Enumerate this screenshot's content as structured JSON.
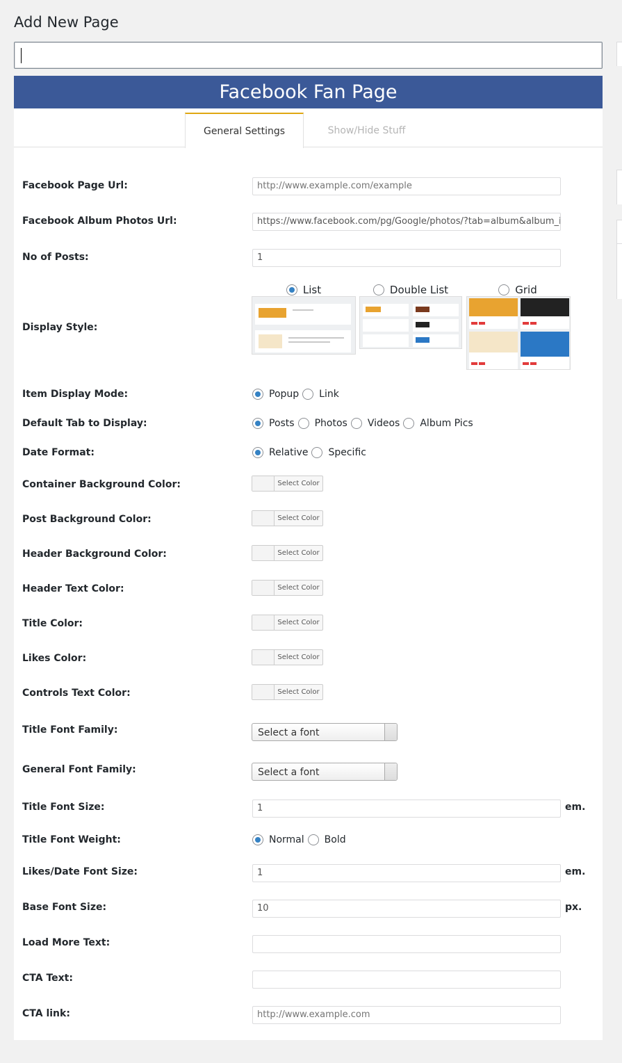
{
  "page": {
    "heading": "Add New Page",
    "title_value": ""
  },
  "banner": {
    "title": "Facebook Fan Page"
  },
  "tabs": [
    {
      "label": "General Settings",
      "active": true
    },
    {
      "label": "Show/Hide Stuff",
      "active": false
    }
  ],
  "fields": {
    "page_url": {
      "label": "Facebook Page Url:",
      "placeholder": "http://www.example.com/example"
    },
    "album_url": {
      "label": "Facebook Album Photos Url:",
      "value": "https://www.facebook.com/pg/Google/photos/?tab=album&album_ic"
    },
    "no_posts": {
      "label": "No of Posts:",
      "value": "1"
    },
    "display_style": {
      "label": "Display Style:",
      "options": [
        {
          "label": "List",
          "checked": true
        },
        {
          "label": "Double List",
          "checked": false
        },
        {
          "label": "Grid",
          "checked": false
        }
      ]
    },
    "item_display_mode": {
      "label": "Item Display Mode:",
      "options": [
        {
          "label": "Popup",
          "checked": true
        },
        {
          "label": "Link",
          "checked": false
        }
      ]
    },
    "default_tab": {
      "label": "Default Tab to Display:",
      "options": [
        {
          "label": "Posts",
          "checked": true
        },
        {
          "label": "Photos",
          "checked": false
        },
        {
          "label": "Videos",
          "checked": false
        },
        {
          "label": "Album Pics",
          "checked": false
        }
      ]
    },
    "date_format": {
      "label": "Date Format:",
      "options": [
        {
          "label": "Relative",
          "checked": true
        },
        {
          "label": "Specific",
          "checked": false
        }
      ]
    },
    "colors": [
      {
        "label": "Container Background Color:",
        "button": "Select Color"
      },
      {
        "label": "Post Background Color:",
        "button": "Select Color"
      },
      {
        "label": "Header Background Color:",
        "button": "Select Color"
      },
      {
        "label": "Header Text Color:",
        "button": "Select Color"
      },
      {
        "label": "Title Color:",
        "button": "Select Color"
      },
      {
        "label": "Likes Color:",
        "button": "Select Color"
      },
      {
        "label": "Controls Text Color:",
        "button": "Select Color"
      }
    ],
    "title_font_family": {
      "label": "Title Font Family:",
      "selected": "Select a font"
    },
    "general_font_family": {
      "label": "General Font Family:",
      "selected": "Select a font"
    },
    "title_font_size": {
      "label": "Title Font Size:",
      "value": "1",
      "unit": "em."
    },
    "title_font_weight": {
      "label": "Title Font Weight:",
      "options": [
        {
          "label": "Normal",
          "checked": true
        },
        {
          "label": "Bold",
          "checked": false
        }
      ]
    },
    "likes_font_size": {
      "label": "Likes/Date Font Size:",
      "value": "1",
      "unit": "em."
    },
    "base_font_size": {
      "label": "Base Font Size:",
      "value": "10",
      "unit": "px."
    },
    "load_more_text": {
      "label": "Load More Text:",
      "value": ""
    },
    "cta_text": {
      "label": "CTA Text:",
      "value": ""
    },
    "cta_link": {
      "label": "CTA link:",
      "placeholder": "http://www.example.com"
    }
  },
  "colors": {
    "brand": "#3b5998",
    "tab_accent": "#e0a712",
    "radio_checked": "#3582c4"
  }
}
